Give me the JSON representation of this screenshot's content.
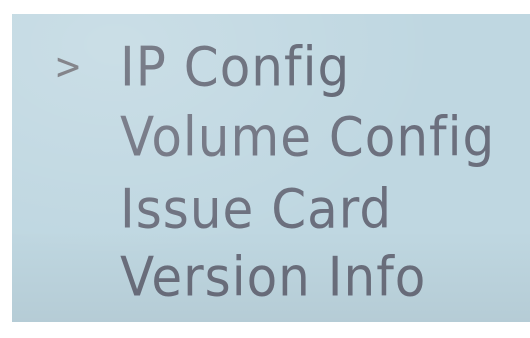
{
  "menu": {
    "selected_marker": ">",
    "items": [
      {
        "label": "IP Config",
        "selected": true
      },
      {
        "label": "Volume Config",
        "selected": false
      },
      {
        "label": "Issue Card",
        "selected": false
      },
      {
        "label": "Version Info",
        "selected": false
      }
    ]
  },
  "colors": {
    "screen_background": "#bfd7e1",
    "text": "#6b6f7d"
  }
}
